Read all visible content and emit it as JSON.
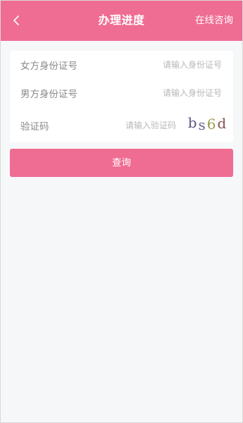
{
  "header": {
    "title": "办理进度",
    "right_action": "在线咨询",
    "back_icon": "chevron-left-icon",
    "background_color": "#ef6c93"
  },
  "form": {
    "female_id": {
      "label": "女方身份证号",
      "value": "",
      "placeholder": "请输入身份证号"
    },
    "male_id": {
      "label": "男方身份证号",
      "value": "",
      "placeholder": "请输入身份证号"
    },
    "captcha": {
      "label": "验证码",
      "value": "",
      "placeholder": "请输入验证码",
      "code": [
        "b",
        "s",
        "6",
        "d"
      ]
    }
  },
  "actions": {
    "query_label": "查询",
    "button_color": "#ef6c93"
  }
}
